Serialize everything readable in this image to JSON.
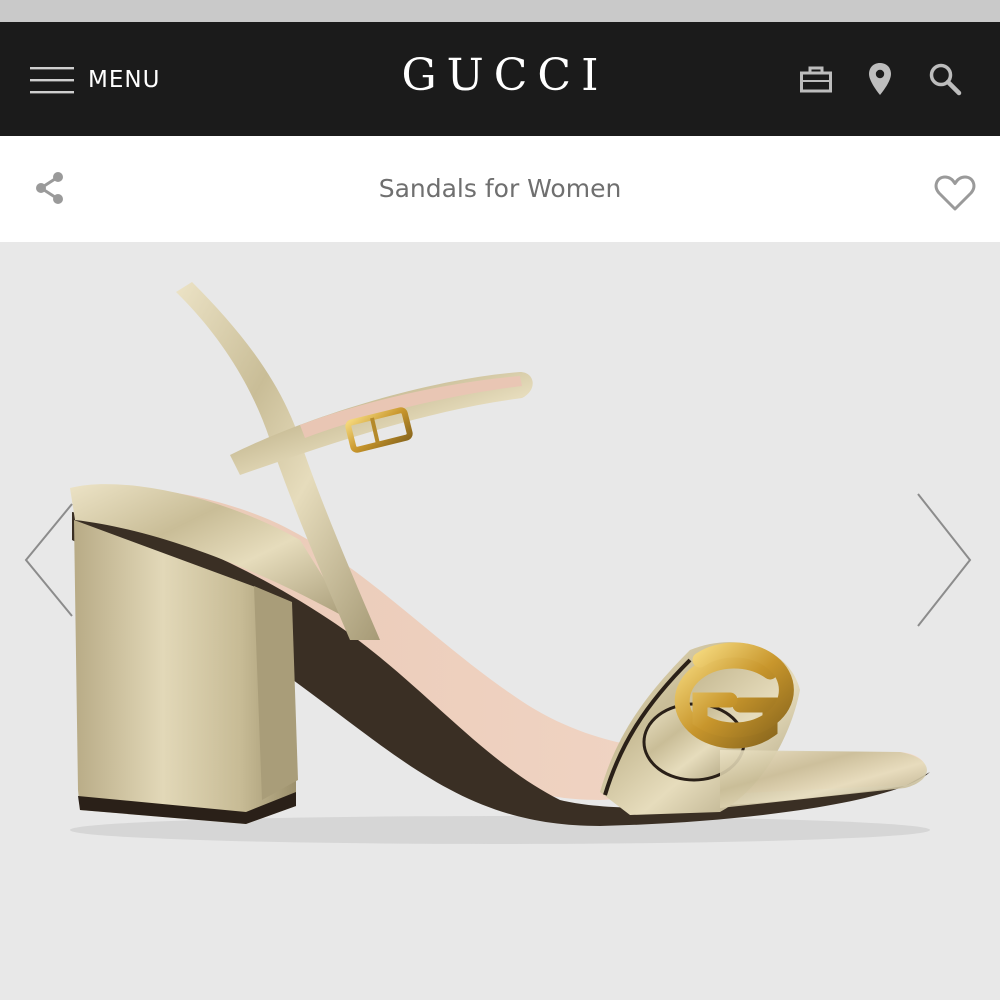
{
  "header": {
    "menu_label": "MENU",
    "brand": "GUCCI",
    "icons": [
      "menu-icon",
      "shopping-bag-icon",
      "location-pin-icon",
      "search-icon"
    ]
  },
  "subheader": {
    "title": "Sandals for Women",
    "icons": [
      "share-icon",
      "heart-icon"
    ]
  },
  "gallery": {
    "image_subject": "gold metallic block-heel sandal with Double G hardware",
    "icons": [
      "chevron-left-icon",
      "chevron-right-icon"
    ]
  },
  "colors": {
    "header_bg": "#1b1b1b",
    "subheader_bg": "#ffffff",
    "gallery_bg": "#e8e8e8",
    "title_text": "#6f6f6f",
    "metallic_gold": "#cfc29a",
    "hardware_gold": "#d2a53a"
  }
}
